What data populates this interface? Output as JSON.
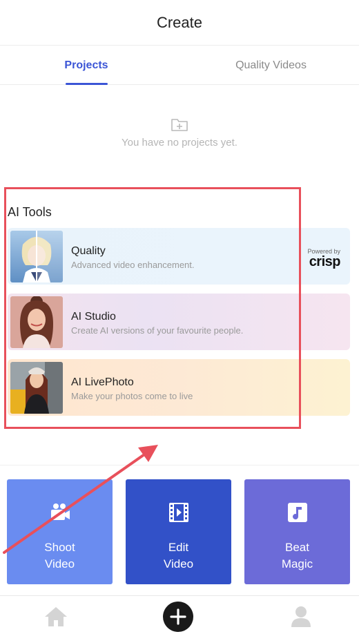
{
  "header": {
    "title": "Create"
  },
  "tabs": [
    {
      "label": "Projects",
      "active": true
    },
    {
      "label": "Quality Videos",
      "active": false
    }
  ],
  "empty_state": {
    "icon": "folder-plus-icon",
    "text": "You have no projects yet."
  },
  "ai_tools": {
    "title": "AI Tools",
    "items": [
      {
        "name": "Quality",
        "description": "Advanced video enhancement.",
        "powered_by": "Powered by",
        "partner": "crisp"
      },
      {
        "name": "AI Studio",
        "description": "Create AI versions of your favourite people."
      },
      {
        "name": "AI LivePhoto",
        "description": "Make your photos come to live"
      }
    ]
  },
  "actions": [
    {
      "line1": "Shoot",
      "line2": "Video",
      "icon": "video-camera-icon",
      "color": "#6a8cf0"
    },
    {
      "line1": "Edit",
      "line2": "Video",
      "icon": "film-icon",
      "color": "#3251c8"
    },
    {
      "line1": "Beat",
      "line2": "Magic",
      "icon": "music-note-icon",
      "color": "#6c6bd8"
    }
  ],
  "bottom_nav": [
    {
      "icon": "home-icon"
    },
    {
      "icon": "plus-circle-icon"
    },
    {
      "icon": "profile-icon"
    }
  ],
  "colors": {
    "accent": "#3b55d6",
    "highlight": "#e8505b"
  }
}
